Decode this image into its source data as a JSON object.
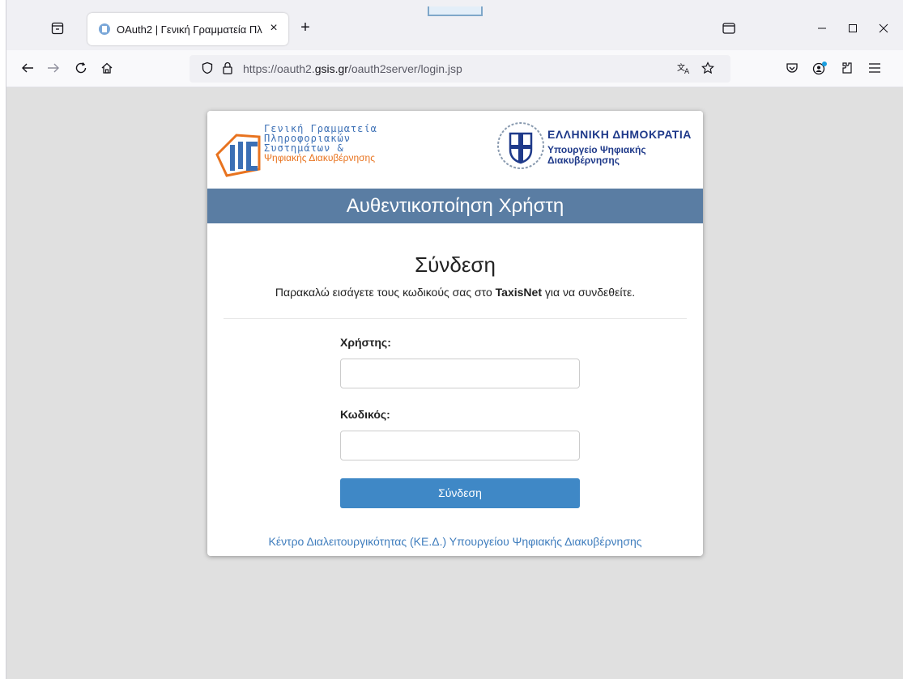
{
  "browser": {
    "tab": {
      "title": "OAuth2 | Γενική Γραμματεία Πλ",
      "close": "×"
    },
    "new_tab": "+",
    "url": {
      "prefix": "https://oauth2.",
      "domain": "gsis.gr",
      "path": "/oauth2server/login.jsp"
    }
  },
  "header": {
    "gsis_logo": [
      "Γενική Γραμματεία",
      "Πληροφοριακών",
      "Συστημάτων &",
      "Ψηφιακής Διακυβέρνησης"
    ],
    "gov_title": "ΕΛΛΗΝΙΚΗ ΔΗΜΟΚΡΑΤΙΑ",
    "gov_sub_1": "Υπουργείο Ψηφιακής",
    "gov_sub_2": "Διακυβέρνησης"
  },
  "band_title": "Αυθεντικοποίηση Χρήστη",
  "login": {
    "heading": "Σύνδεση",
    "subtitle_pre": "Παρακαλώ εισάγετε τους κωδικούς σας στο ",
    "subtitle_bold": "TaxisNet",
    "subtitle_post": " για να συνδεθείτε.",
    "user_label": "Χρήστης:",
    "user_value": "",
    "pass_label": "Κωδικός:",
    "pass_value": "",
    "submit_label": "Σύνδεση"
  },
  "footer_link": "Κέντρο Διαλειτουργικότητας (ΚΕ.Δ.) Υπουργείου Ψηφιακής Διακυβέρνησης",
  "colors": {
    "band": "#5a7da3",
    "button": "#3f88c6",
    "link": "#3f7dbd"
  }
}
